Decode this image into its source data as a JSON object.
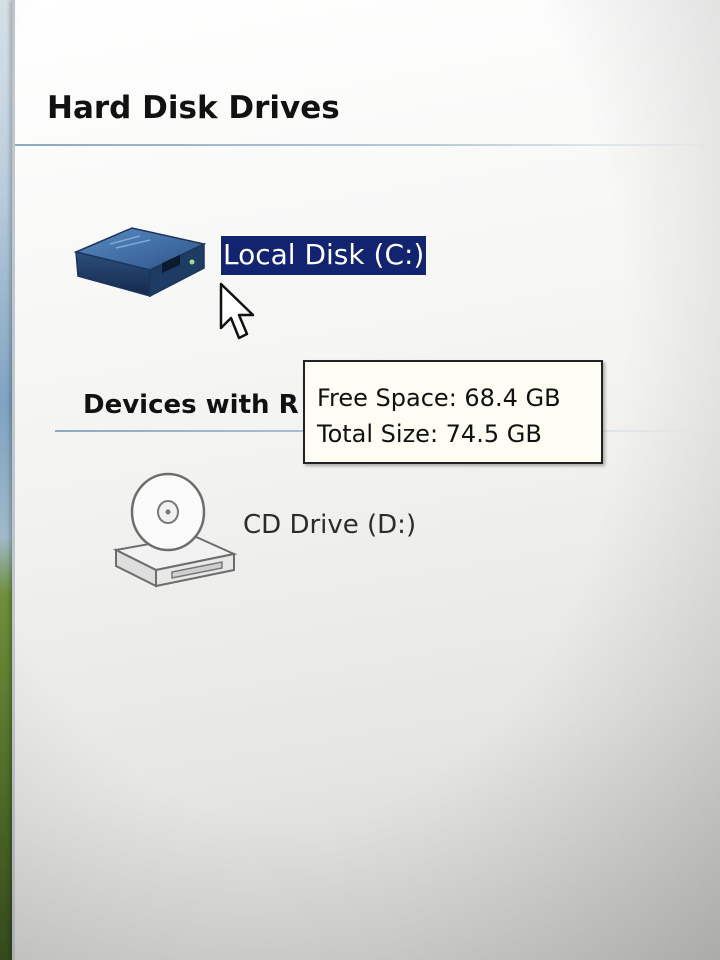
{
  "explorer": {
    "groups": [
      {
        "header": "Hard Disk Drives",
        "items": [
          {
            "label": "Local Disk (C:)",
            "icon": "hard-disk-icon",
            "selected": true
          }
        ]
      },
      {
        "header": "Devices with R",
        "items": [
          {
            "label": "CD Drive (D:)",
            "icon": "cd-drive-icon",
            "selected": false
          }
        ]
      }
    ]
  },
  "tooltip": {
    "free_space": "Free Space: 68.4 GB",
    "total_size": "Total Size: 74.5 GB"
  },
  "colors": {
    "selection": "#12246f",
    "selection_text": "#ffffff",
    "tooltip_bg": "#fdfdf4",
    "hdd_icon": "#2f5f93"
  }
}
